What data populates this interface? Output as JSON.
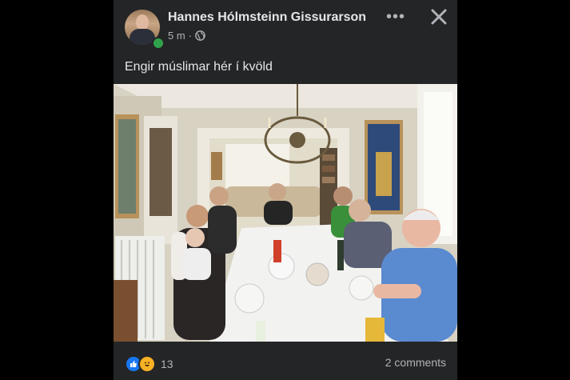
{
  "post": {
    "author": "Hannes Hólmsteinn Gissurarson",
    "time": "5 m",
    "separator": "·",
    "caption": "Engir múslimar hér í kvöld",
    "more_label": "•••",
    "audience_icon": "globe-icon",
    "close_icon": "close-icon"
  },
  "photo": {
    "icon": "dinner-photo"
  },
  "footer": {
    "reaction_count": "13",
    "comments_label": "2 comments"
  },
  "colors": {
    "card_bg": "#242526",
    "text_primary": "#e4e6eb",
    "text_secondary": "#b0b3b8",
    "online": "#31a24c",
    "like": "#1877f2"
  }
}
